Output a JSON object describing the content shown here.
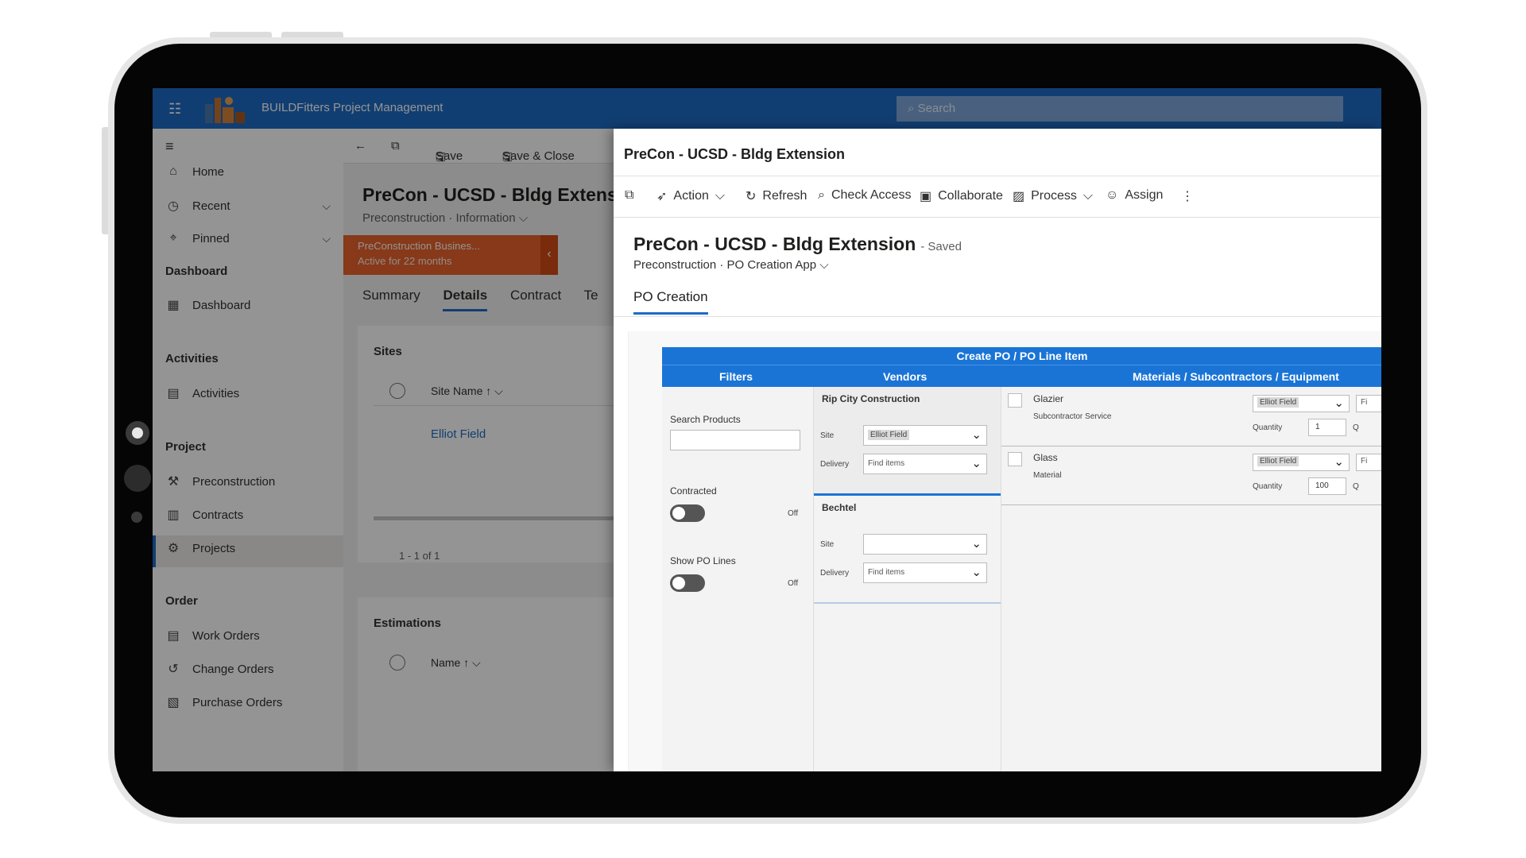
{
  "topbar": {
    "title": "BUILDFitters Project Management",
    "search_placeholder": "Search",
    "waffle_icon": "waffle-icon"
  },
  "nav": {
    "items": [
      {
        "label": "Home",
        "icon": "home-icon"
      },
      {
        "label": "Recent",
        "icon": "clock-icon"
      },
      {
        "label": "Pinned",
        "icon": "pin-icon"
      }
    ],
    "sections": [
      "Dashboard",
      "Activities",
      "Project",
      "Order"
    ],
    "dashboard_item": "Dashboard",
    "activities_item": "Activities",
    "project_items": [
      "Preconstruction",
      "Contracts",
      "Projects"
    ],
    "order_items": [
      "Work Orders",
      "Change Orders",
      "Purchase Orders"
    ]
  },
  "background": {
    "cmd": {
      "save": "Save",
      "save_close": "Save & Close"
    },
    "title": "PreCon - UCSD - Bldg Extens",
    "subtitle": "Preconstruction · Information ⌵",
    "banner_title": "PreConstruction Busines...",
    "banner_sub": "Active for 22 months",
    "tabs": [
      "Summary",
      "Details",
      "Contract",
      "Te"
    ],
    "sites": {
      "title": "Sites",
      "column": "Site Name ↑ ⌵",
      "row": "Elliot Field",
      "paging": "1 - 1 of 1"
    },
    "estimations": {
      "title": "Estimations",
      "column": "Name ↑ ⌵"
    }
  },
  "dialog": {
    "header_title": "PreCon - UCSD - Bldg Extension",
    "commands": [
      "Action",
      "Refresh",
      "Check Access",
      "Collaborate",
      "Process",
      "Assign"
    ],
    "record_title": "PreCon - UCSD - Bldg Extension",
    "record_status": "- Saved",
    "record_sub": "Preconstruction · PO Creation App ⌵",
    "tab": "PO Creation"
  },
  "app": {
    "banner": "Create PO / PO Line Item",
    "col_filters": "Filters",
    "col_vendors": "Vendors",
    "col_materials": "Materials / Subcontractors / Equipment",
    "filters": {
      "search_label": "Search Products",
      "contracted_label": "Contracted",
      "contracted_state": "Off",
      "show_po_label": "Show PO Lines",
      "show_po_state": "Off"
    },
    "vendors": [
      {
        "name": "Rip City Construction",
        "site_label": "Site",
        "site_value": "Elliot Field",
        "delivery_label": "Delivery",
        "delivery_value": "Find items"
      },
      {
        "name": "Bechtel",
        "site_label": "Site",
        "site_value": "",
        "delivery_label": "Delivery",
        "delivery_value": "Find items"
      }
    ],
    "materials": [
      {
        "name": "Glazier",
        "type": "Subcontractor Service",
        "site": "Elliot Field",
        "qty_label": "Quantity",
        "qty": "1",
        "extra": "Fi",
        "extra2": "Q"
      },
      {
        "name": "Glass",
        "type": "Material",
        "site": "Elliot Field",
        "qty_label": "Quantity",
        "qty": "100",
        "extra": "Fi",
        "extra2": "Q"
      }
    ]
  }
}
